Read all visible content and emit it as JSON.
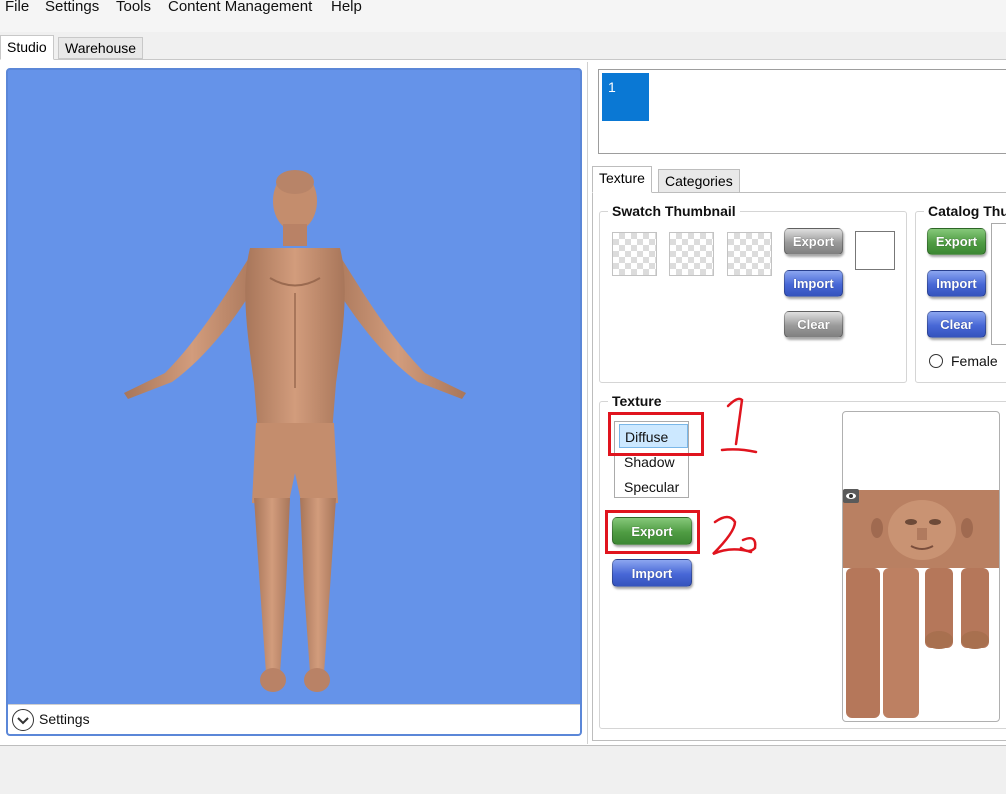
{
  "menu": [
    "File",
    "Settings",
    "Tools",
    "Content Management",
    "Help"
  ],
  "tabs": {
    "studio": "Studio",
    "warehouse": "Warehouse"
  },
  "viewport": {
    "settings_label": "Settings",
    "background_color": "#6593e9"
  },
  "thumbnails": {
    "item_1": "1"
  },
  "inner_tabs": {
    "texture": "Texture",
    "categories": "Categories"
  },
  "swatch": {
    "title": "Swatch Thumbnail",
    "export": "Export",
    "import": "Import",
    "clear": "Clear"
  },
  "catalog": {
    "title": "Catalog Thu",
    "export": "Export",
    "import": "Import",
    "clear": "Clear",
    "female_label": "Female"
  },
  "texture": {
    "title": "Texture",
    "options": [
      "Diffuse",
      "Shadow",
      "Specular"
    ],
    "selected": "Diffuse",
    "export": "Export",
    "import": "Import"
  },
  "annotations": {
    "step_1": "1",
    "step_2": "2",
    "highlight_color": "#e0141e"
  },
  "colors": {
    "accent_blue": "#0a78d4",
    "button_green": "#4f9c43",
    "button_blue": "#4767d6",
    "button_gray": "#9a9a9a"
  }
}
